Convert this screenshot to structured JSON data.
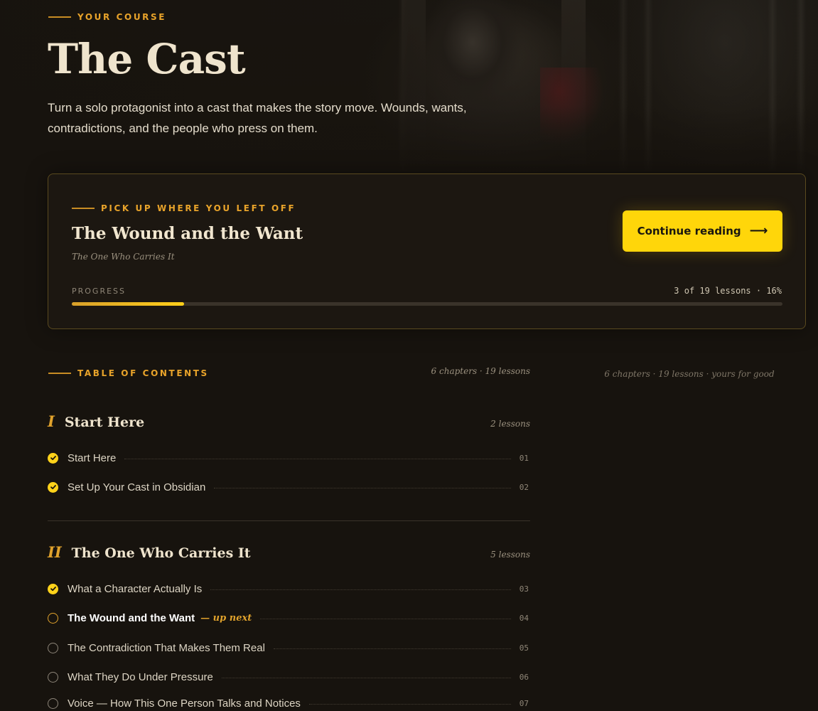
{
  "hero": {
    "eyebrow": "YOUR COURSE",
    "title": "The Cast",
    "description": "Turn a solo protagonist into a cast that makes the story move. Wounds, wants, contradictions, and the people who press on them."
  },
  "resume": {
    "eyebrow": "PICK UP WHERE YOU LEFT OFF",
    "lesson_title": "The Wound and the Want",
    "chapter_name": "The One Who Carries It",
    "button_label": "Continue reading",
    "button_icon": "arrow-right-icon",
    "progress_label": "PROGRESS",
    "progress_text": "3 of 19 lessons · 16%",
    "progress_fraction": 0.158
  },
  "toc": {
    "eyebrow": "TABLE OF CONTENTS",
    "meta": "6 chapters · 19 lessons",
    "side_meta": "6 chapters · 19 lessons · yours for good",
    "chapters": [
      {
        "numeral": "I",
        "title": "Start Here",
        "count": "2 lessons",
        "lessons": [
          {
            "title": "Start Here",
            "num": "01",
            "status": "done"
          },
          {
            "title": "Set Up Your Cast in Obsidian",
            "num": "02",
            "status": "done"
          }
        ]
      },
      {
        "numeral": "II",
        "title": "The One Who Carries It",
        "count": "5 lessons",
        "lessons": [
          {
            "title": "What a Character Actually Is",
            "num": "03",
            "status": "done"
          },
          {
            "title": "The Wound and the Want",
            "num": "04",
            "status": "next",
            "badge": "— up next"
          },
          {
            "title": "The Contradiction That Makes Them Real",
            "num": "05",
            "status": "todo"
          },
          {
            "title": "What They Do Under Pressure",
            "num": "06",
            "status": "todo"
          },
          {
            "title": "Voice — How This One Person Talks and Notices",
            "num": "07",
            "status": "todo"
          }
        ]
      }
    ]
  },
  "colors": {
    "background": "#17130e",
    "accent": "#e8a32a",
    "button": "#ffd60a",
    "text": "#efe4cd"
  }
}
